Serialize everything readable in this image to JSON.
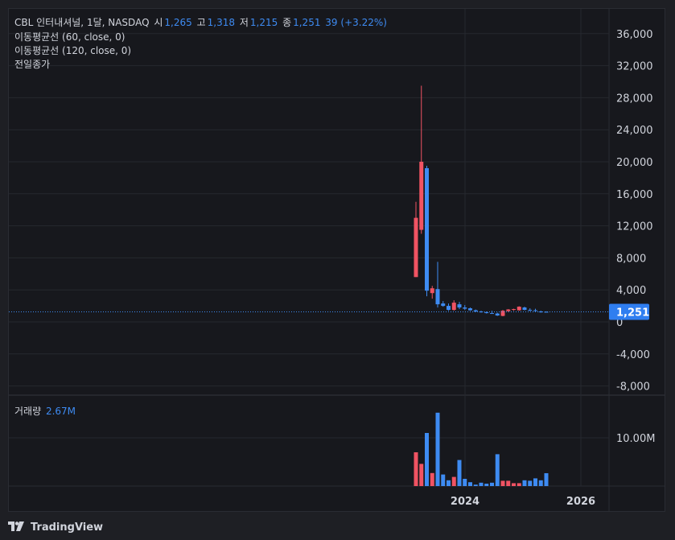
{
  "header": {
    "symbol": "CBL 인터내셔널, 1달, NASDAQ",
    "open_label": "시",
    "open": "1,265",
    "high_label": "고",
    "high": "1,318",
    "low_label": "저",
    "low": "1,215",
    "close_label": "종",
    "close": "1,251",
    "change": "39 (+3.22%)",
    "indicators": [
      "이동평균선 (60, close, 0)",
      "이동평균선 (120, close, 0)",
      "전일종가"
    ]
  },
  "volume_panel": {
    "label": "거래량",
    "value": "2.67M"
  },
  "price_tag": "1,251",
  "footer": {
    "brand": "TradingView"
  },
  "colors": {
    "up": "#f05363",
    "down": "#3e8bf2",
    "bg": "#17181d",
    "grid": "#26282e",
    "text": "#d1d4dc"
  },
  "chart_data": {
    "type": "candlestick",
    "timeframe": "1 month",
    "price_axis": {
      "ticks": [
        36000,
        32000,
        28000,
        24000,
        20000,
        16000,
        12000,
        8000,
        4000,
        0,
        -4000,
        -8000
      ],
      "tick_labels": [
        "36,000",
        "32,000",
        "28,000",
        "24,000",
        "20,000",
        "16,000",
        "12,000",
        "8,000",
        "4,000",
        "0",
        "-4,000",
        "-8,000"
      ],
      "range": [
        -9000,
        38000
      ]
    },
    "volume_axis": {
      "ticks": [
        10000000
      ],
      "tick_labels": [
        "10.00M"
      ],
      "range": [
        0,
        17000000
      ]
    },
    "time_axis": {
      "labels": [
        "2024",
        "2026"
      ]
    },
    "last_price": 1251,
    "candles": [
      {
        "o": 5600,
        "h": 15000,
        "l": 5600,
        "c": 13000
      },
      {
        "o": 11500,
        "h": 29500,
        "l": 11000,
        "c": 20000
      },
      {
        "o": 19200,
        "h": 19500,
        "l": 3200,
        "c": 3900
      },
      {
        "o": 3600,
        "h": 4500,
        "l": 2900,
        "c": 4200
      },
      {
        "o": 4100,
        "h": 7500,
        "l": 1800,
        "c": 2200
      },
      {
        "o": 2300,
        "h": 2600,
        "l": 1900,
        "c": 2000
      },
      {
        "o": 2000,
        "h": 2300,
        "l": 1400,
        "c": 1500
      },
      {
        "o": 1500,
        "h": 2700,
        "l": 1400,
        "c": 2400
      },
      {
        "o": 2200,
        "h": 2500,
        "l": 1600,
        "c": 1800
      },
      {
        "o": 1800,
        "h": 2100,
        "l": 1500,
        "c": 1650
      },
      {
        "o": 1700,
        "h": 1800,
        "l": 1400,
        "c": 1450
      },
      {
        "o": 1450,
        "h": 1550,
        "l": 1250,
        "c": 1300
      },
      {
        "o": 1300,
        "h": 1400,
        "l": 1150,
        "c": 1200
      },
      {
        "o": 1200,
        "h": 1300,
        "l": 1050,
        "c": 1100
      },
      {
        "o": 1100,
        "h": 1400,
        "l": 1000,
        "c": 1050
      },
      {
        "o": 1050,
        "h": 1150,
        "l": 750,
        "c": 800
      },
      {
        "o": 750,
        "h": 1500,
        "l": 700,
        "c": 1400
      },
      {
        "o": 1350,
        "h": 1600,
        "l": 1250,
        "c": 1550
      },
      {
        "o": 1500,
        "h": 1650,
        "l": 1400,
        "c": 1600
      },
      {
        "o": 1450,
        "h": 1950,
        "l": 1400,
        "c": 1900
      },
      {
        "o": 1800,
        "h": 1900,
        "l": 1450,
        "c": 1500
      },
      {
        "o": 1500,
        "h": 1700,
        "l": 1350,
        "c": 1450
      },
      {
        "o": 1450,
        "h": 1650,
        "l": 1300,
        "c": 1350
      },
      {
        "o": 1300,
        "h": 1400,
        "l": 1150,
        "c": 1215
      },
      {
        "o": 1265,
        "h": 1318,
        "l": 1215,
        "c": 1251
      }
    ],
    "volumes": [
      7000000,
      4600000,
      11000000,
      2700000,
      15200000,
      2400000,
      1200000,
      1900000,
      5400000,
      1500000,
      800000,
      300000,
      700000,
      500000,
      700000,
      6600000,
      1100000,
      1100000,
      600000,
      600000,
      1200000,
      1100000,
      1600000,
      1200000,
      2670000
    ]
  }
}
